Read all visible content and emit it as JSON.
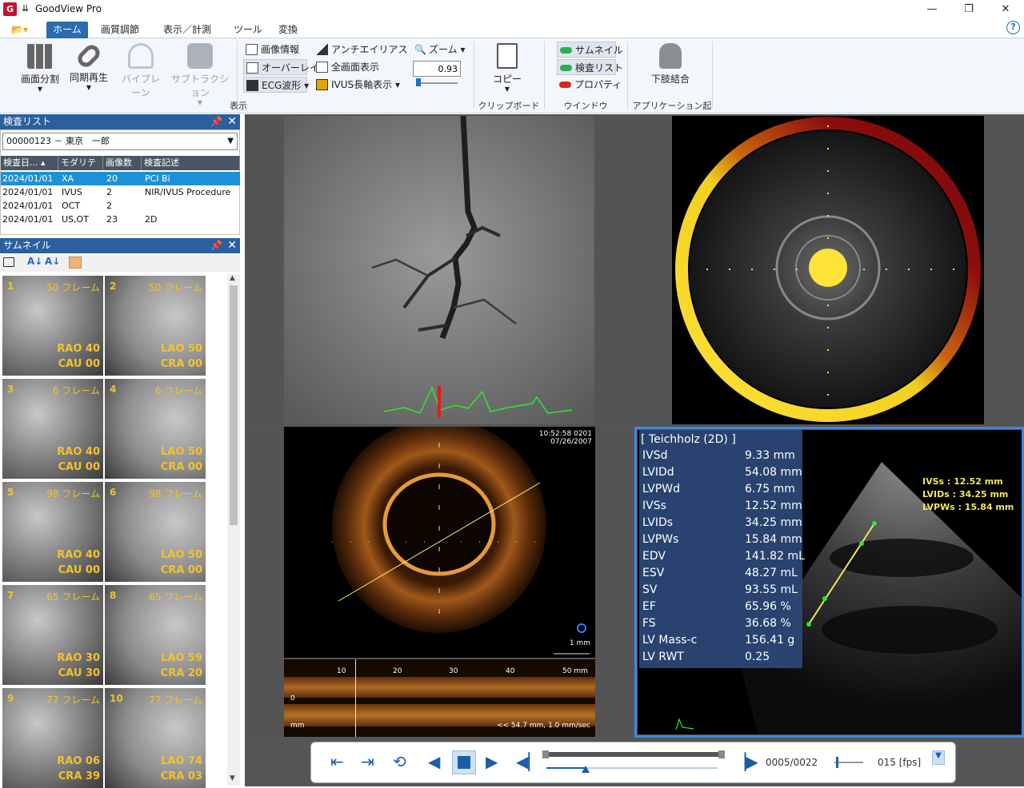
{
  "window": {
    "title": "GoodView Pro",
    "icon_letter": "G",
    "quick_access": "⇊",
    "minimize": "—",
    "restore": "❐",
    "close": "✕"
  },
  "menubar": {
    "file_menu": "📂▾",
    "tabs": [
      "ホーム",
      "画質調節",
      "表示／計測",
      "ツール",
      "変換"
    ],
    "help": "?"
  },
  "ribbon": {
    "big_buttons": [
      "画面分割",
      "同期再生",
      "バイプレーン",
      "サブトラクション"
    ],
    "small_buttons": {
      "image_info": "画像情報",
      "overlay": "オーバーレイ",
      "ecg": "ECG波形",
      "antialias": "アンチエイリアス",
      "fullscreen": "全画面表示",
      "ivus_long": "IVUS長軸表示"
    },
    "zoom": {
      "label": "ズーム",
      "value": "0.93"
    },
    "copy": "コピー",
    "window_items": [
      "サムネイル",
      "検査リスト",
      "プロパティ"
    ],
    "app_launch": "下肢結合",
    "groups": [
      "表示",
      "クリップボード",
      "ウインドウ",
      "アプリケーション起動"
    ]
  },
  "exam_list": {
    "title": "検査リスト",
    "pin": "📌",
    "close": "✕",
    "patient": "00000123 － 東京　一郎",
    "columns": [
      "検査日... ▴",
      "モダリティ",
      "画像数",
      "検査記述"
    ],
    "rows": [
      [
        "2024/01/01",
        "XA",
        "20",
        "PCI Bi"
      ],
      [
        "2024/01/01",
        "IVUS",
        "2",
        "NIR/IVUS Procedure"
      ],
      [
        "2024/01/01",
        "OCT",
        "2",
        ""
      ],
      [
        "2024/01/01",
        "US,OT",
        "23",
        "2D"
      ]
    ]
  },
  "thumbnails": {
    "title": "サムネイル",
    "pin": "📌",
    "close": "✕",
    "items": [
      {
        "n": "1",
        "f": "50 フレーム",
        "a": "RAO 40",
        "b": "CAU 00"
      },
      {
        "n": "2",
        "f": "50 フレーム",
        "a": "LAO 50",
        "b": "CRA 00"
      },
      {
        "n": "3",
        "f": "6 フレーム",
        "a": "RAO 40",
        "b": "CAU 00"
      },
      {
        "n": "4",
        "f": "6 フレーム",
        "a": "LAO 50",
        "b": "CRA 00"
      },
      {
        "n": "5",
        "f": "98 フレーム",
        "a": "RAO 40",
        "b": "CAU 00"
      },
      {
        "n": "6",
        "f": "98 フレーム",
        "a": "LAO 50",
        "b": "CRA 00"
      },
      {
        "n": "7",
        "f": "65 フレーム",
        "a": "RAO 30",
        "b": "CAU 30"
      },
      {
        "n": "8",
        "f": "65 フレーム",
        "a": "LAO 59",
        "b": "CRA 20"
      },
      {
        "n": "9",
        "f": "77 フレーム",
        "a": "RAO 06",
        "b": "CRA 39"
      },
      {
        "n": "10",
        "f": "77 フレーム",
        "a": "LAO 74",
        "b": "CRA 03"
      }
    ]
  },
  "oct": {
    "time": "10:52:58  0201",
    "date": "07/26/2007",
    "scale": "1 mm",
    "ticks": [
      "10",
      "20",
      "30",
      "40",
      "50 mm"
    ],
    "zero": "0",
    "unit": "mm",
    "speed": "<< 54.7 mm, 1.0 mm/sec"
  },
  "echo": {
    "header": "[ Teichholz (2D) ]",
    "measurements": [
      [
        "IVSd",
        "9.33 mm"
      ],
      [
        "LVIDd",
        "54.08 mm"
      ],
      [
        "LVPWd",
        "6.75 mm"
      ],
      [
        "IVSs",
        "12.52 mm"
      ],
      [
        "LVIDs",
        "34.25 mm"
      ],
      [
        "LVPWs",
        "15.84 mm"
      ],
      [
        "EDV",
        "141.82 mL"
      ],
      [
        "ESV",
        "48.27 mL"
      ],
      [
        "SV",
        "93.55 mL"
      ],
      [
        "EF",
        "65.96 %"
      ],
      [
        "FS",
        "36.68 %"
      ],
      [
        "LV Mass-c",
        "156.41 g"
      ],
      [
        "LV RWT",
        "0.25"
      ]
    ],
    "overlay": [
      "IVSs : 12.52 mm",
      "LVIDs : 34.25 mm",
      "LVPWs : 15.84 mm"
    ]
  },
  "playback": {
    "frame": "0005/0022",
    "fps": "015 [fps]",
    "frame_progress": 0.23
  }
}
